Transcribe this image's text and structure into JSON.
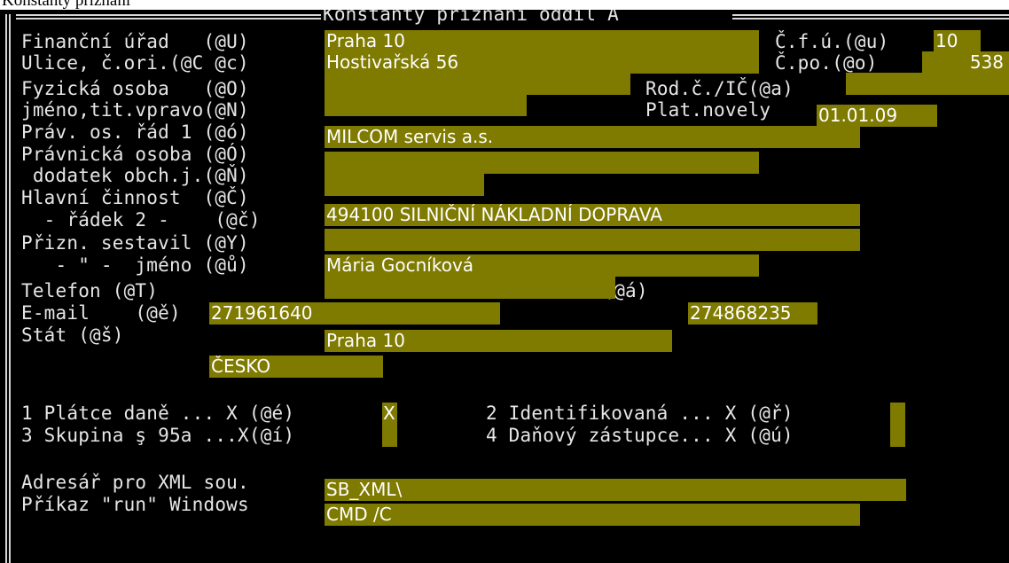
{
  "window": {
    "title": "Konstanty přiznání"
  },
  "frame": {
    "title": "Konstanty přiznání oddíl A"
  },
  "labels": {
    "financni_urad": "Finanční úřad   (@U)",
    "ulice": "Ulice, č.ori.(@C @c)",
    "fyzicka_osoba": "Fyzická osoba   (@O)",
    "jmeno_tit": "jméno,tit.vpravo(@N)",
    "prav_os": "Práv. os. řád 1 (@ó)",
    "pravnicka_osoba": "Právnická osoba (@Ó)",
    "dodatek": " dodatek obch.j.(@Ň)",
    "hlavni_cinnost": "Hlavní činnost  (@Č)",
    "radek2": "  - řádek 2 -    (@č)",
    "prizn_sestavil": "Přizn. sestavil (@Y)",
    "jmeno_ditto": "   - \" -  jméno (@ů)",
    "telefon": "Telefon (@T)",
    "email": "E-mail    (@ě)",
    "stat": "Stát (@š)",
    "cfu": "Č.f.ú.(@u)",
    "cpo": "Č.po.(@o)",
    "rod_c": "Rod.č./IČ(@a)",
    "plat_novely": "Plat.novely",
    "fax": "Fax (@á)",
    "platce": "1 Plátce daně ... X (@é)",
    "identifikovana": "2 Identifikovaná ... X (@ř)",
    "skupina": "3 Skupina ş 95a ...X(@í)",
    "danovy_zastupce": "4 Daňový zástupce... X (@ú)",
    "adresar": "Adresář pro XML sou.",
    "prikaz": "Příkaz \"run\" Windows"
  },
  "values": {
    "financni_urad": "Praha 10",
    "cfu": "10",
    "ulice": "Hostivařská 56",
    "cpo": "538",
    "fyzicka_osoba": "",
    "rod_c": "",
    "jmeno_tit": "",
    "plat_novely": "01.01.09",
    "prav_os": "MILCOM servis a.s.",
    "pravnicka_osoba": "",
    "dodatek": "",
    "hlavni_cinnost": "494100 SILNIČNÍ NÁKLADNÍ DOPRAVA",
    "radek2": "",
    "prizn_sestavil": "Mária Gocníková",
    "jmeno_ditto": "",
    "telefon": "271961640",
    "fax": "274868235",
    "email": "Praha 10",
    "stat": "ČESKO",
    "platce": "X",
    "identifikovana": "",
    "skupina": "",
    "danovy_zastupce": "",
    "adresar": "SB_XML\\",
    "prikaz": "CMD /C"
  },
  "colors": {
    "field_bg": "#7f7a00",
    "console_bg": "#000000",
    "text": "#e6e6e6",
    "field_text": "#ffffff"
  }
}
